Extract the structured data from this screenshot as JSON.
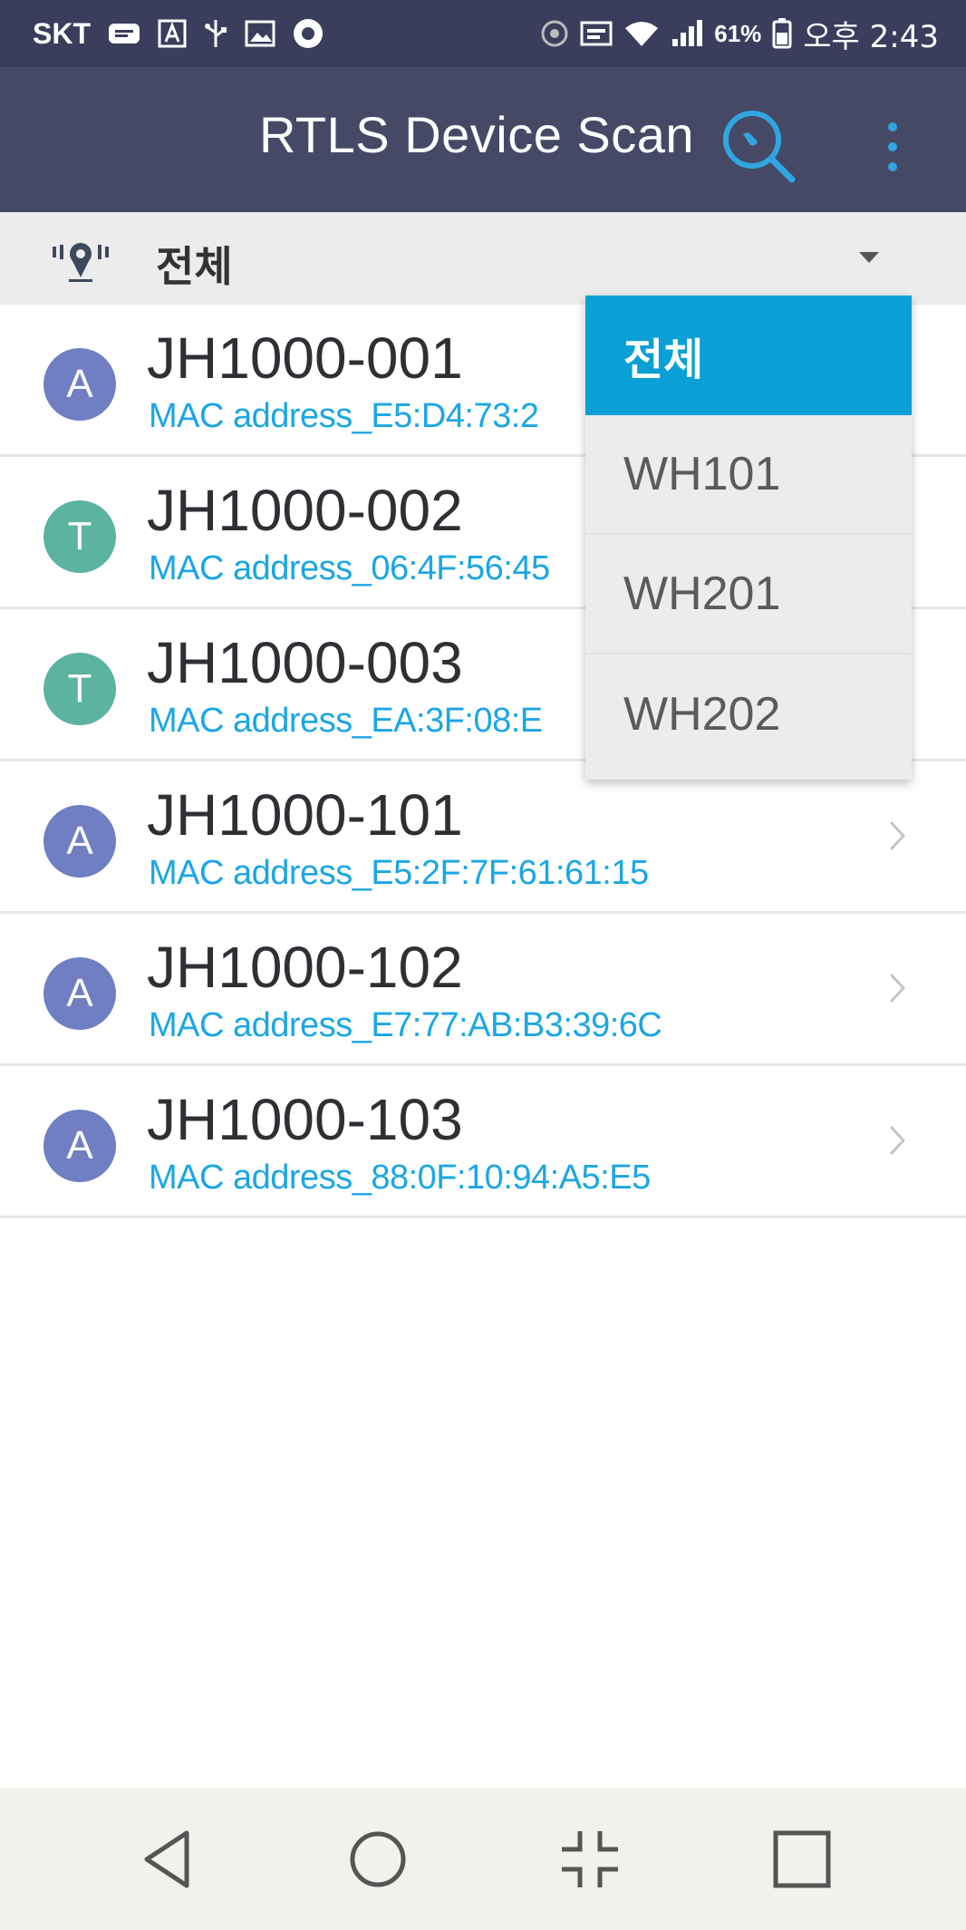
{
  "status_bar": {
    "carrier": "SKT",
    "battery": "61%",
    "time": "오후 2:43"
  },
  "app_bar": {
    "title": "RTLS Device Scan",
    "icons": [
      "search-icon",
      "more-vert-icon"
    ]
  },
  "filter": {
    "selected": "전체",
    "icon": "location-pin-icon"
  },
  "dropdown": {
    "options": [
      "전체",
      "WH101",
      "WH201",
      "WH202"
    ],
    "selected_index": 0
  },
  "devices": [
    {
      "badge": "A",
      "name": "JH1000-001",
      "mac": "MAC address_E5:D4:73:2",
      "color": "#6f7fc2"
    },
    {
      "badge": "T",
      "name": "JH1000-002",
      "mac": "MAC address_06:4F:56:45",
      "color": "#5cb3a0"
    },
    {
      "badge": "T",
      "name": "JH1000-003",
      "mac": "MAC address_EA:3F:08:E",
      "color": "#5cb3a0"
    },
    {
      "badge": "A",
      "name": "JH1000-101",
      "mac": "MAC address_E5:2F:7F:61:61:15",
      "color": "#6f7fc2"
    },
    {
      "badge": "A",
      "name": "JH1000-102",
      "mac": "MAC address_E7:77:AB:B3:39:6C",
      "color": "#6f7fc2"
    },
    {
      "badge": "A",
      "name": "JH1000-103",
      "mac": "MAC address_88:0F:10:94:A5:E5",
      "color": "#6f7fc2"
    }
  ],
  "nav_bar": {
    "icons": [
      "back-icon",
      "home-icon",
      "split-screen-icon",
      "recents-icon"
    ]
  },
  "colors": {
    "accent": "#0aa0d6",
    "app_bar": "#454966",
    "status_bar": "#3a3d5c"
  }
}
